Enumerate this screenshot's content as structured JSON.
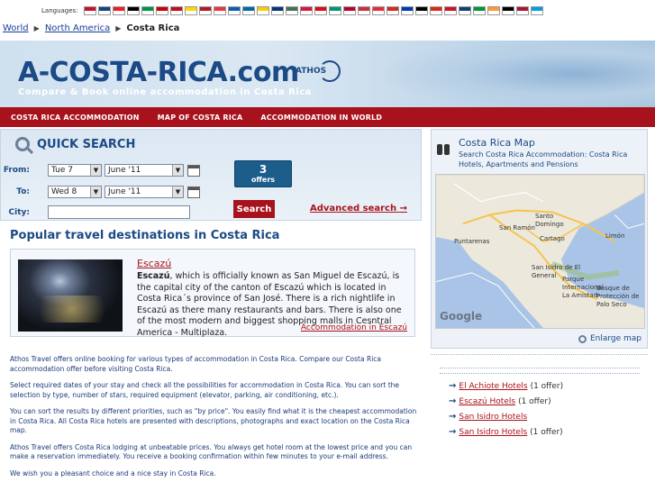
{
  "languages": {
    "label": "Languages:",
    "flag_colors": [
      "#c8102e",
      "#11457e",
      "#ee1c25",
      "#000000",
      "#009246",
      "#cc0000",
      "#c60b1e",
      "#ffd700",
      "#ae1c28",
      "#ef3340",
      "#0d5eaf",
      "#006aa7",
      "#ffcc00",
      "#003580",
      "#477050",
      "#dc143c",
      "#e30a17",
      "#00966e",
      "#bc002d",
      "#cd2e3a",
      "#ed2939",
      "#d52b1e",
      "#0038b8",
      "#000000",
      "#de2910",
      "#ce1126",
      "#0c4076",
      "#009639",
      "#ff9933",
      "#000000",
      "#a51931",
      "#00a0de"
    ]
  },
  "breadcrumb": {
    "items": [
      "World",
      "North America"
    ],
    "current": "Costa Rica"
  },
  "header": {
    "brand": "A-COSTA-RICA",
    "brand_tld": ".com",
    "tagline": "Compare & Book online accommodation in Costa Rica",
    "partner": "ATHOS"
  },
  "nav": {
    "items": [
      "COSTA RICA ACCOMMODATION",
      "MAP OF COSTA RICA",
      "ACCOMMODATION IN WORLD"
    ]
  },
  "search": {
    "title": "QUICK SEARCH",
    "from_label": "From:",
    "to_label": "To:",
    "city_label": "City:",
    "from_day": "Tue 7",
    "from_month": "June '11",
    "to_day": "Wed 8",
    "to_month": "June '11",
    "city_value": "",
    "offers_count": "3",
    "offers_label": "offers",
    "search_button": "Search",
    "advanced_link": "Advanced search"
  },
  "popular": {
    "title": "Popular travel destinations in Costa Rica",
    "destination": {
      "name": "Escazú",
      "bold_name": "Escazú",
      "description": ", which is officially known as San Miguel de Escazú, is the capital city of the canton of Escazú which is located in Costa Rica´s province of San José. There is a rich nightlife in Escazú as there many restaurants and bars. There is also one of the most modern and biggest shopping malls in Cesntral America - Multiplaza.",
      "link": "Accommodation in Escazú"
    }
  },
  "info": {
    "paragraphs": [
      "Athos Travel offers online booking for various types of accommodation in Costa Rica. Compare our Costa Rica accommodation offer before visiting Costa Rica.",
      "Select required dates of your stay and check all the possibilities for accommodation in Costa Rica. You can sort the selection by type, number of stars, required equipment (elevator, parking, air conditioning, etc.).",
      "You can sort the results by different priorities, such as \"by price\". You easily find what it is the cheapest accommodation in Costa Rica. All Costa Rica hotels are presented with descriptions, photographs and exact location on the Costa Rica map.",
      "Athos Travel offers Costa Rica lodging at unbeatable prices. You always get hotel room at the lowest price and you can make a reservation immediately. You receive a booking confirmation within few minutes to your e-mail address.",
      "We wish you a pleasant choice and a nice stay in Costa Rica."
    ]
  },
  "map": {
    "title": "Costa Rica Map",
    "subtitle": "Search Costa Rica Accommodation: Costa Rica Hotels, Apartments and Pensions",
    "places": [
      "San Ramón",
      "Puntarenas",
      "Santo Domingo",
      "Cartago",
      "Limón",
      "San Isidro de El General",
      "Parque Internacional La Amistad",
      "Bosque de Protección de Palo Seco"
    ],
    "watermark": "Google",
    "enlarge_link": "Enlarge map"
  },
  "hotels": {
    "items": [
      {
        "name": "El Achiote Hotels",
        "count": "(1 offer)"
      },
      {
        "name": "Escazú Hotels",
        "count": "(1 offer)"
      },
      {
        "name": "San Isidro Hotels",
        "count": ""
      },
      {
        "name": "San Isidro Hotels",
        "count": "(1 offer)"
      }
    ]
  },
  "colors": {
    "brand_blue": "#1b4a86",
    "nav_red": "#a8121c"
  }
}
